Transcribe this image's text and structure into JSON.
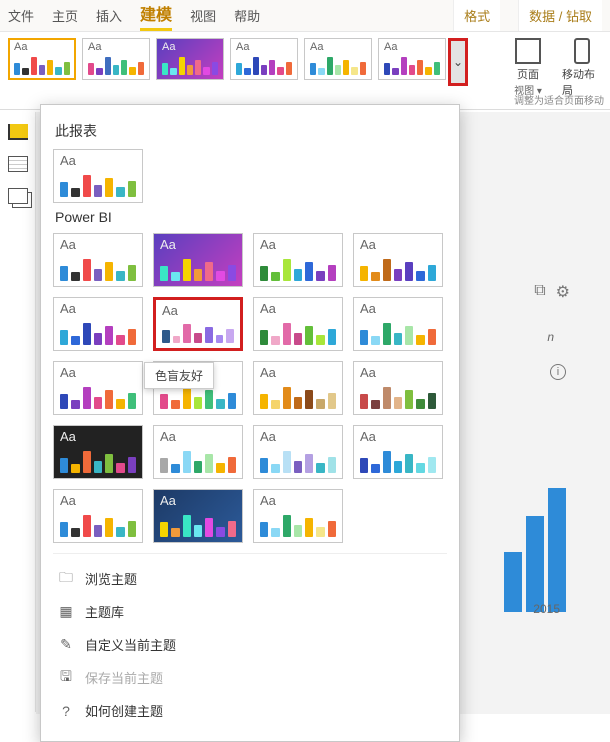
{
  "tabs": {
    "file": "文件",
    "home": "主页",
    "insert": "插入",
    "modeling": "建模",
    "view": "视图",
    "help": "帮助",
    "format": "格式",
    "data_drill": "数据 / 钻取"
  },
  "ribbon": {
    "dropdown_glyph": "⌄",
    "page": "页面",
    "page_view": "视图 ▾",
    "mobile": "移动布局",
    "fit": "调整为适合页面移动"
  },
  "panel": {
    "this_report": "此报表",
    "powerbi": "Power BI",
    "tooltip": "色盲友好",
    "menu": {
      "browse": "浏览主题",
      "gallery": "主题库",
      "customize": "自定义当前主题",
      "save": "保存当前主题",
      "how": "如何创建主题"
    }
  },
  "peek": {
    "year": "2015",
    "n": "n",
    "info": "i",
    "ico1": "⧉",
    "ico2": "⚙"
  },
  "themes": {
    "strip": [
      {
        "bg": "",
        "colors": [
          "#2e8bd8",
          "#333333",
          "#f04a4a",
          "#7a5fc0",
          "#f5b400",
          "#39b6c5",
          "#7fbf3f"
        ]
      },
      {
        "bg": "",
        "colors": [
          "#e24a8b",
          "#7a3fbf",
          "#3f6ebf",
          "#39b6c5",
          "#3fbf7a",
          "#f5b400",
          "#f06a3a"
        ]
      },
      {
        "bg": "grad",
        "colors": [
          "#39e6c5",
          "#6ae6f0",
          "#f5d400",
          "#f09a3a",
          "#f06a8a",
          "#e24ae2",
          "#8a4ae2"
        ]
      },
      {
        "bg": "",
        "colors": [
          "#2ea8d8",
          "#2e68d8",
          "#2e48b8",
          "#7a3fbf",
          "#b43fbf",
          "#e24a8b",
          "#f06a3a"
        ]
      },
      {
        "bg": "",
        "colors": [
          "#2e8bd8",
          "#8ad8f5",
          "#2ea868",
          "#a8e6a8",
          "#f5b400",
          "#f5e68a",
          "#f06a3a"
        ]
      },
      {
        "bg": "",
        "colors": [
          "#2e48b8",
          "#7a3fbf",
          "#b43fbf",
          "#e24a8b",
          "#f06a3a",
          "#f5b400",
          "#3fbf7a"
        ]
      }
    ],
    "this_report": [
      {
        "bg": "",
        "colors": [
          "#2e8bd8",
          "#333333",
          "#f04a4a",
          "#7a5fc0",
          "#f5b400",
          "#39b6c5",
          "#7fbf3f"
        ]
      }
    ],
    "powerbi": [
      {
        "bg": "",
        "colors": [
          "#2e8bd8",
          "#333333",
          "#f04a4a",
          "#7a5fc0",
          "#f5b400",
          "#39b6c5",
          "#7fbf3f"
        ]
      },
      {
        "bg": "grad",
        "colors": [
          "#39e6c5",
          "#6ae6f0",
          "#f5d400",
          "#f09a3a",
          "#f06a8a",
          "#e24ae2",
          "#8a4ae2"
        ]
      },
      {
        "bg": "",
        "colors": [
          "#2e8b3a",
          "#63bf3a",
          "#a8e63a",
          "#2ea8d8",
          "#2e68d8",
          "#7a3fbf",
          "#b43fbf"
        ]
      },
      {
        "bg": "",
        "colors": [
          "#f5b400",
          "#e28b1a",
          "#bf6a1a",
          "#7a3fbf",
          "#5a3fbf",
          "#2e68d8",
          "#2ea8d8"
        ]
      },
      {
        "bg": "",
        "colors": [
          "#2ea8d8",
          "#2e68d8",
          "#2e48b8",
          "#7a3fbf",
          "#b43fbf",
          "#e24a8b",
          "#f06a3a"
        ]
      },
      {
        "bg": "",
        "colors": [
          "#2e5a8b",
          "#f0a8c8",
          "#e26aa8",
          "#c84a8b",
          "#8a6ae2",
          "#a88af0",
          "#c8a8f0"
        ],
        "hl": "red"
      },
      {
        "bg": "",
        "colors": [
          "#2e8b3a",
          "#f0a8c8",
          "#e26aa8",
          "#c84a8b",
          "#63bf3a",
          "#a8e63a",
          "#2ea8d8"
        ]
      },
      {
        "bg": "",
        "colors": [
          "#2e8bd8",
          "#8ad8f5",
          "#2ea868",
          "#39b6c5",
          "#a8e6a8",
          "#f5b400",
          "#f06a3a"
        ]
      },
      {
        "bg": "",
        "colors": [
          "#2e48b8",
          "#7a3fbf",
          "#b43fbf",
          "#e24a8b",
          "#f06a3a",
          "#f5b400",
          "#3fbf7a"
        ]
      },
      {
        "bg": "",
        "colors": [
          "#e24a8b",
          "#f06a3a",
          "#f5b400",
          "#a8e63a",
          "#3fbf7a",
          "#39b6c5",
          "#2e8bd8"
        ]
      },
      {
        "bg": "",
        "colors": [
          "#f5b400",
          "#f5d46a",
          "#e28b1a",
          "#bf6a1a",
          "#8b4a1a",
          "#c8a86a",
          "#e2c88a"
        ]
      },
      {
        "bg": "",
        "colors": [
          "#c84a4a",
          "#7a3f3f",
          "#bf8a6a",
          "#e2b48a",
          "#7fbf3f",
          "#3f8b3a",
          "#2e5a3a"
        ]
      },
      {
        "bg": "dark",
        "colors": [
          "#2e8bd8",
          "#f5b400",
          "#f06a3a",
          "#39b6c5",
          "#7fbf3f",
          "#e24a8b",
          "#7a3fbf"
        ]
      },
      {
        "bg": "",
        "colors": [
          "#a8a8a8",
          "#2e8bd8",
          "#8ad8f5",
          "#2ea868",
          "#a8e6a8",
          "#f5b400",
          "#f06a3a"
        ]
      },
      {
        "bg": "",
        "colors": [
          "#2e8bd8",
          "#8ad8f5",
          "#b8e0f5",
          "#7a5fc0",
          "#b4a0e2",
          "#39b6c5",
          "#a0e2e8"
        ]
      },
      {
        "bg": "",
        "colors": [
          "#2e48b8",
          "#2e68d8",
          "#2e8bd8",
          "#2ea8d8",
          "#39b6c5",
          "#63d8e2",
          "#a0e8f0"
        ]
      },
      {
        "bg": "",
        "colors": [
          "#2e8bd8",
          "#333333",
          "#f04a4a",
          "#7a5fc0",
          "#f5b400",
          "#39b6c5",
          "#7fbf3f"
        ]
      },
      {
        "bg": "navy",
        "colors": [
          "#f5d400",
          "#f09a3a",
          "#39e6c5",
          "#6ae6f0",
          "#e24ae2",
          "#8a4ae2",
          "#f06a8a"
        ]
      },
      {
        "bg": "",
        "colors": [
          "#2e8bd8",
          "#8ad8f5",
          "#2ea868",
          "#a8e6a8",
          "#f5b400",
          "#f5e68a",
          "#f06a3a"
        ]
      }
    ]
  }
}
